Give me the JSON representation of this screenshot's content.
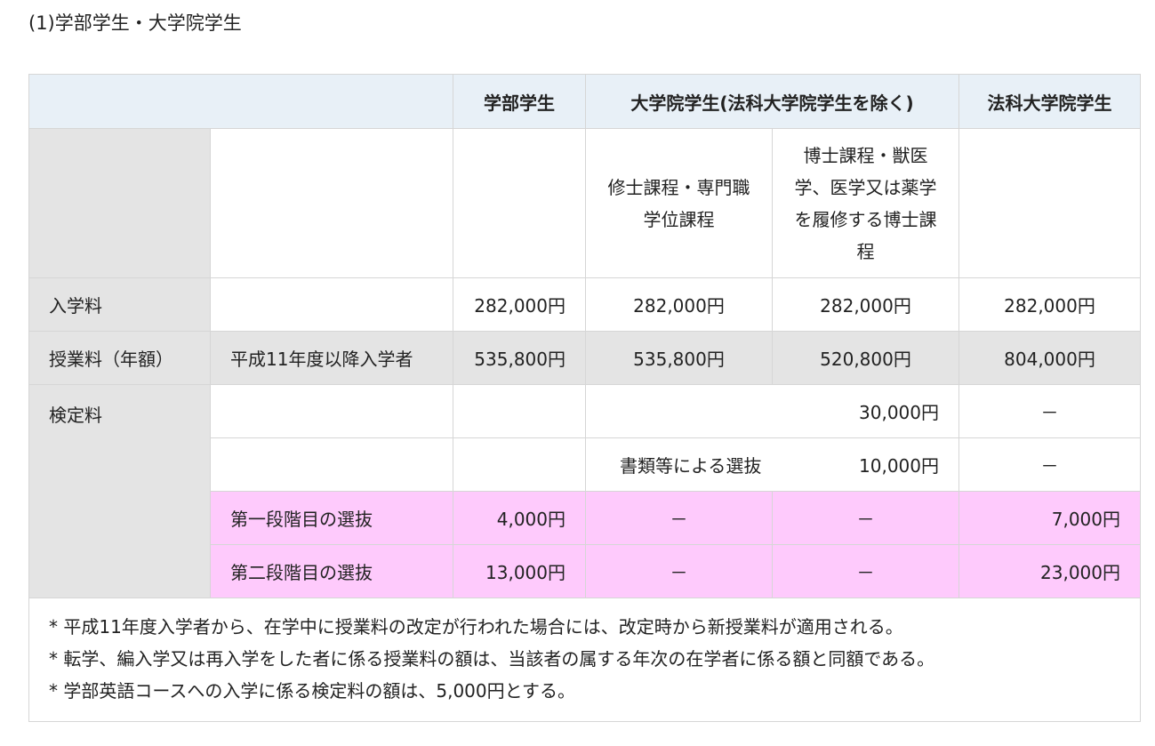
{
  "section_title": "(1)学部学生・大学院学生",
  "header": {
    "undergrad": "学部学生",
    "grad": "大学院学生(法科大学院学生を除く)",
    "law": "法科大学院学生"
  },
  "subheader": {
    "master": "修士課程・専門職学位課程",
    "doctor": "博士課程・獣医学、医学又は薬学を履修する博士課程"
  },
  "rows": {
    "admission": {
      "label": "入学料",
      "undergrad": "282,000円",
      "master": "282,000円",
      "doctor": "282,000円",
      "law": "282,000円"
    },
    "tuition": {
      "label": "授業料（年額）",
      "sub": "平成11年度以降入学者",
      "undergrad": "535,800円",
      "master": "535,800円",
      "doctor": "520,800円",
      "law": "804,000円"
    },
    "exam": {
      "label": "検定料",
      "r1": {
        "grad": "30,000円",
        "law": "－"
      },
      "r2": {
        "grad_label": "書類等による選抜",
        "grad": "10,000円",
        "law": "－"
      },
      "r3": {
        "sub": "第一段階目の選抜",
        "undergrad": "4,000円",
        "master": "－",
        "doctor": "－",
        "law": "7,000円"
      },
      "r4": {
        "sub": "第二段階目の選抜",
        "undergrad": "13,000円",
        "master": "－",
        "doctor": "－",
        "law": "23,000円"
      }
    }
  },
  "notes": [
    "* 平成11年度入学者から、在学中に授業料の改定が行われた場合には、改定時から新授業料が適用される。",
    "* 転学、編入学又は再入学をした者に係る授業料の額は、当該者の属する年次の在学者に係る額と同額である。",
    "* 学部英語コースへの入学に係る検定料の額は、5,000円とする。"
  ],
  "colors": {
    "header_bg": "#e8f0f7",
    "grey_bg": "#e4e4e4",
    "pink_bg": "#fecafc",
    "border": "#d6d6d6"
  }
}
